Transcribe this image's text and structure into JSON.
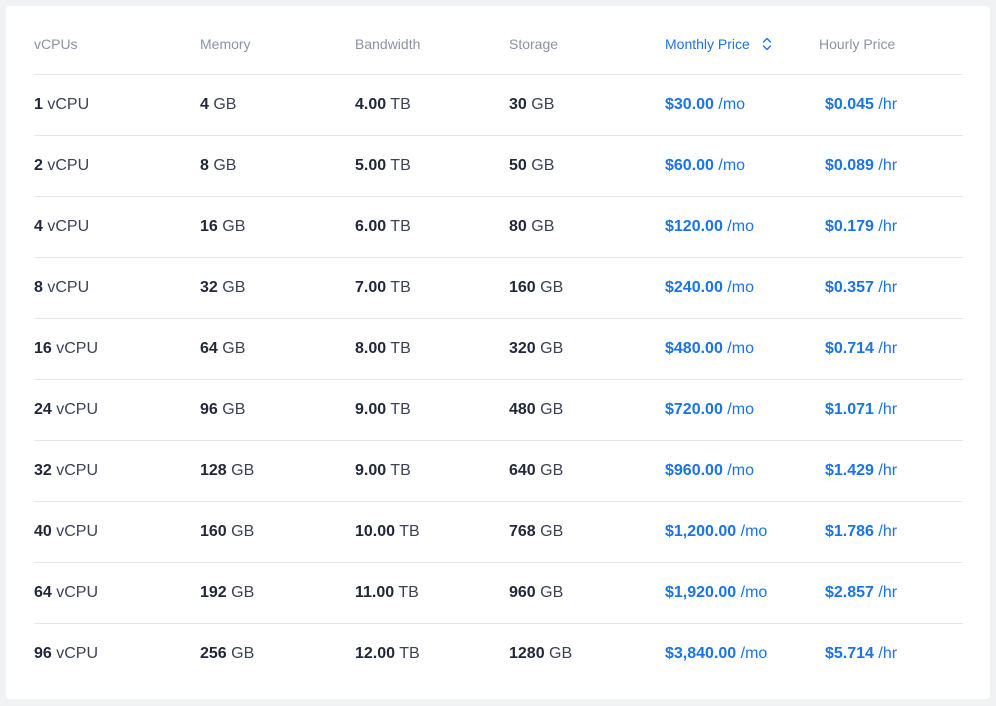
{
  "table": {
    "headers": {
      "vcpus": "vCPUs",
      "memory": "Memory",
      "bandwidth": "Bandwidth",
      "storage": "Storage",
      "monthly": "Monthly Price",
      "hourly": "Hourly Price"
    },
    "sort": {
      "column": "Monthly Price",
      "icon": "sort-up-down-chevron-icon",
      "color": "#1a73e8"
    },
    "rows": [
      {
        "vcpu": "1",
        "vcpu_unit": "vCPU",
        "memory": "4",
        "memory_unit": "GB",
        "bandwidth": "4.00",
        "bandwidth_unit": "TB",
        "storage": "30",
        "storage_unit": "GB",
        "monthly": "$30.00",
        "monthly_unit": "/mo",
        "hourly": "$0.045",
        "hourly_unit": "/hr"
      },
      {
        "vcpu": "2",
        "vcpu_unit": "vCPU",
        "memory": "8",
        "memory_unit": "GB",
        "bandwidth": "5.00",
        "bandwidth_unit": "TB",
        "storage": "50",
        "storage_unit": "GB",
        "monthly": "$60.00",
        "monthly_unit": "/mo",
        "hourly": "$0.089",
        "hourly_unit": "/hr"
      },
      {
        "vcpu": "4",
        "vcpu_unit": "vCPU",
        "memory": "16",
        "memory_unit": "GB",
        "bandwidth": "6.00",
        "bandwidth_unit": "TB",
        "storage": "80",
        "storage_unit": "GB",
        "monthly": "$120.00",
        "monthly_unit": "/mo",
        "hourly": "$0.179",
        "hourly_unit": "/hr"
      },
      {
        "vcpu": "8",
        "vcpu_unit": "vCPU",
        "memory": "32",
        "memory_unit": "GB",
        "bandwidth": "7.00",
        "bandwidth_unit": "TB",
        "storage": "160",
        "storage_unit": "GB",
        "monthly": "$240.00",
        "monthly_unit": "/mo",
        "hourly": "$0.357",
        "hourly_unit": "/hr"
      },
      {
        "vcpu": "16",
        "vcpu_unit": "vCPU",
        "memory": "64",
        "memory_unit": "GB",
        "bandwidth": "8.00",
        "bandwidth_unit": "TB",
        "storage": "320",
        "storage_unit": "GB",
        "monthly": "$480.00",
        "monthly_unit": "/mo",
        "hourly": "$0.714",
        "hourly_unit": "/hr"
      },
      {
        "vcpu": "24",
        "vcpu_unit": "vCPU",
        "memory": "96",
        "memory_unit": "GB",
        "bandwidth": "9.00",
        "bandwidth_unit": "TB",
        "storage": "480",
        "storage_unit": "GB",
        "monthly": "$720.00",
        "monthly_unit": "/mo",
        "hourly": "$1.071",
        "hourly_unit": "/hr"
      },
      {
        "vcpu": "32",
        "vcpu_unit": "vCPU",
        "memory": "128",
        "memory_unit": "GB",
        "bandwidth": "9.00",
        "bandwidth_unit": "TB",
        "storage": "640",
        "storage_unit": "GB",
        "monthly": "$960.00",
        "monthly_unit": "/mo",
        "hourly": "$1.429",
        "hourly_unit": "/hr"
      },
      {
        "vcpu": "40",
        "vcpu_unit": "vCPU",
        "memory": "160",
        "memory_unit": "GB",
        "bandwidth": "10.00",
        "bandwidth_unit": "TB",
        "storage": "768",
        "storage_unit": "GB",
        "monthly": "$1,200.00",
        "monthly_unit": "/mo",
        "hourly": "$1.786",
        "hourly_unit": "/hr"
      },
      {
        "vcpu": "64",
        "vcpu_unit": "vCPU",
        "memory": "192",
        "memory_unit": "GB",
        "bandwidth": "11.00",
        "bandwidth_unit": "TB",
        "storage": "960",
        "storage_unit": "GB",
        "monthly": "$1,920.00",
        "monthly_unit": "/mo",
        "hourly": "$2.857",
        "hourly_unit": "/hr"
      },
      {
        "vcpu": "96",
        "vcpu_unit": "vCPU",
        "memory": "256",
        "memory_unit": "GB",
        "bandwidth": "12.00",
        "bandwidth_unit": "TB",
        "storage": "1280",
        "storage_unit": "GB",
        "monthly": "$3,840.00",
        "monthly_unit": "/mo",
        "hourly": "$5.714",
        "hourly_unit": "/hr"
      }
    ]
  }
}
